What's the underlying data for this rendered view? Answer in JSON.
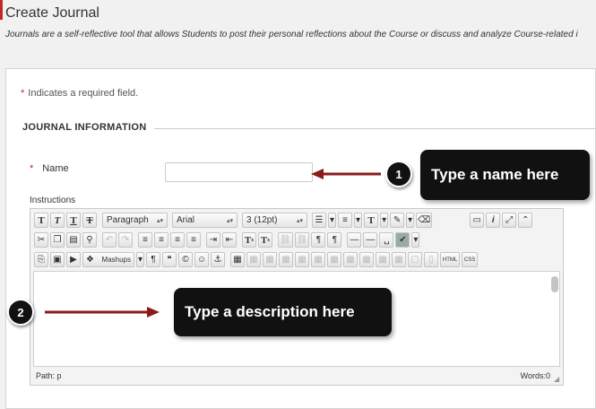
{
  "page": {
    "title": "Create Journal",
    "description": "Journals are a self-reflective tool that allows Students to post their personal reflections about the Course or discuss and analyze Course-related i"
  },
  "form": {
    "required_note": "Indicates a required field.",
    "required_marker": "*",
    "section_title": "JOURNAL INFORMATION",
    "name_label": "Name",
    "name_value": "",
    "instructions_label": "Instructions"
  },
  "editor": {
    "row1": {
      "b": "T",
      "i": "T",
      "u": "T",
      "s": "T",
      "paragraph": "Paragraph",
      "font": "Arial",
      "size": "3 (12pt)",
      "text_color": "T"
    },
    "row2": {
      "superscript": "T",
      "subscript": "T"
    },
    "row3": {
      "mashups": "Mashups",
      "html": "HTML",
      "css": "CSS"
    },
    "path": "Path: p",
    "words": "Words:0"
  },
  "callouts": [
    {
      "number": "1",
      "text": "Type a name here"
    },
    {
      "number": "2",
      "text": "Type a description here"
    }
  ],
  "colors": {
    "required_star": "#c0282c",
    "arrow": "#8b1a1a",
    "callout_bg": "#111111"
  }
}
